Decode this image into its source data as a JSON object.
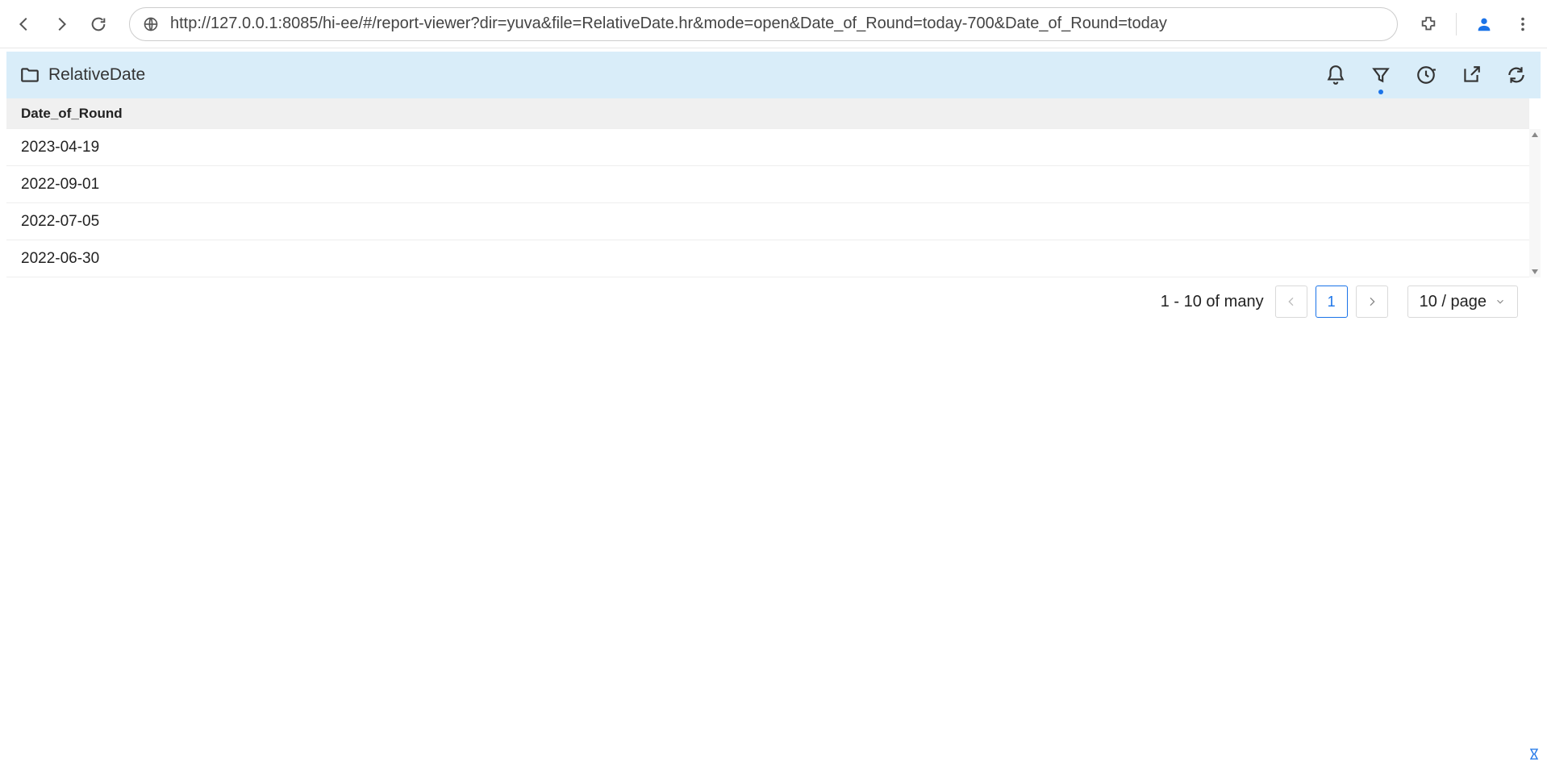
{
  "browser": {
    "url": "http://127.0.0.1:8085/hi-ee/#/report-viewer?dir=yuva&file=RelativeDate.hr&mode=open&Date_of_Round=today-700&Date_of_Round=today"
  },
  "header": {
    "title": "RelativeDate"
  },
  "table": {
    "column": "Date_of_Round",
    "rows": [
      "2023-04-19",
      "2022-09-01",
      "2022-07-05",
      "2022-06-30"
    ]
  },
  "pagination": {
    "range": "1 - 10 of many",
    "current": "1",
    "page_size_label": "10 / page"
  }
}
